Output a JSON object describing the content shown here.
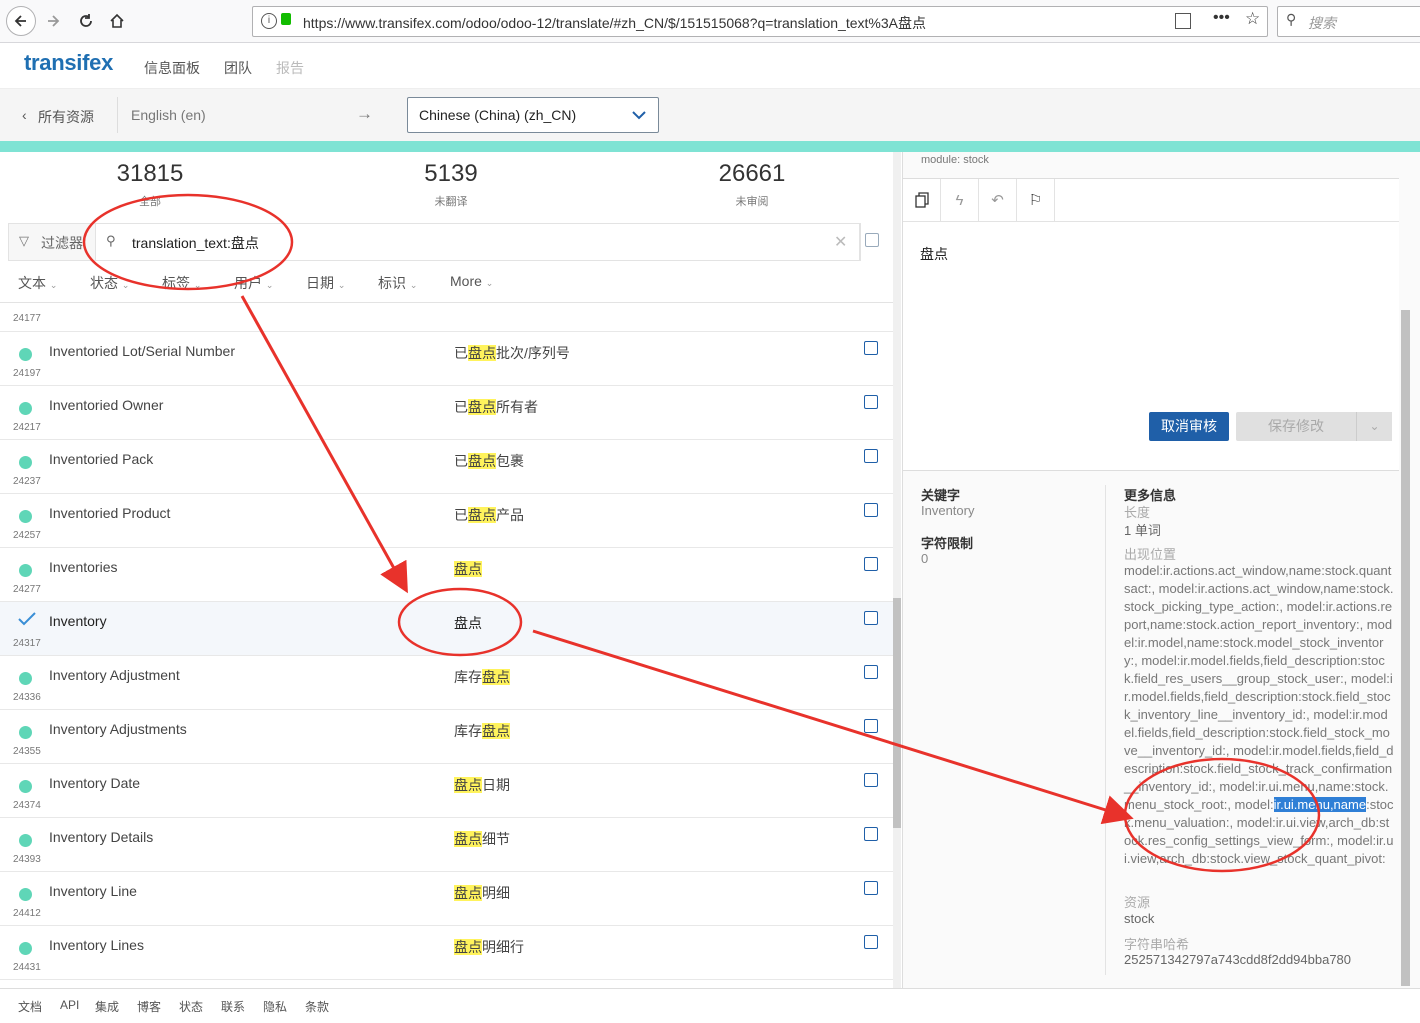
{
  "browser": {
    "url": "https://www.transifex.com/odoo/odoo-12/translate/#zh_CN/$/151515068?q=translation_text%3A盘点",
    "search_placeholder": "搜索",
    "url_icon": "info-icon",
    "menu_icon": "more-icon",
    "star_icon": "star-icon"
  },
  "app": {
    "logo": "transifex",
    "nav": [
      "信息面板",
      "团队",
      "报告"
    ]
  },
  "lang": {
    "back_label": "所有资源",
    "source": "English (en)",
    "arrow": "→",
    "target": "Chinese (China) (zh_CN)"
  },
  "stats": [
    {
      "value": "31815",
      "label": "全部"
    },
    {
      "value": "5139",
      "label": "未翻译"
    },
    {
      "value": "26661",
      "label": "未审阅"
    }
  ],
  "filter": {
    "label": "过滤器",
    "query": "translation_text:盘点"
  },
  "sort_options": [
    "文本",
    "状态",
    "标签",
    "用户",
    "日期",
    "标识",
    "More"
  ],
  "rows": [
    {
      "id": "24177",
      "source": "",
      "pre": "",
      "hl": "",
      "post": ""
    },
    {
      "id": "24197",
      "source": "Inventoried Lot/Serial Number",
      "pre": "已",
      "hl": "盘点",
      "post": "批次/序列号"
    },
    {
      "id": "24217",
      "source": "Inventoried Owner",
      "pre": "已",
      "hl": "盘点",
      "post": "所有者"
    },
    {
      "id": "24237",
      "source": "Inventoried Pack",
      "pre": "已",
      "hl": "盘点",
      "post": "包裹"
    },
    {
      "id": "24257",
      "source": "Inventoried Product",
      "pre": "已",
      "hl": "盘点",
      "post": "产品"
    },
    {
      "id": "24277",
      "source": "Inventories",
      "pre": "",
      "hl": "盘点",
      "post": ""
    },
    {
      "id": "24317",
      "source": "Inventory",
      "pre": "盘点",
      "hl": "",
      "post": ""
    },
    {
      "id": "24336",
      "source": "Inventory Adjustment",
      "pre": "库存",
      "hl": "盘点",
      "post": ""
    },
    {
      "id": "24355",
      "source": "Inventory Adjustments",
      "pre": "库存",
      "hl": "盘点",
      "post": ""
    },
    {
      "id": "24374",
      "source": "Inventory Date",
      "pre": "",
      "hl": "盘点",
      "post": "日期"
    },
    {
      "id": "24393",
      "source": "Inventory Details",
      "pre": "",
      "hl": "盘点",
      "post": "细节"
    },
    {
      "id": "24412",
      "source": "Inventory Line",
      "pre": "",
      "hl": "盘点",
      "post": "明细"
    },
    {
      "id": "24431",
      "source": "Inventory Lines",
      "pre": "",
      "hl": "盘点",
      "post": "明细行"
    }
  ],
  "editor": {
    "module": "module: stock",
    "text": "盘点",
    "cancel_review": "取消审核",
    "save": "保存修改",
    "tools": [
      "copy-icon",
      "lightning-icon",
      "undo-icon",
      "pin-icon"
    ]
  },
  "details": {
    "keyword_label": "关键字",
    "keyword": "Inventory",
    "char_limit_label": "字符限制",
    "char_limit": "0",
    "more_info_label": "更多信息",
    "length_label": "长度",
    "length": "1 单词",
    "occurrences_label": "出现位置",
    "occ_before": "model:ir.actions.act_window,name:stock.quantsact:, model:ir.actions.act_window,name:stock.stock_picking_type_action:, model:ir.actions.report,name:stock.action_report_inventory:, model:ir.model,name:stock.model_stock_inventory:, model:ir.model.fields,field_description:stock.field_res_users__group_stock_user:, model:ir.model.fields,field_description:stock.field_stock_inventory_line__inventory_id:, model:ir.model.fields,field_description:stock.field_stock_move__inventory_id:, model:ir.model.fields,field_description:stock.field_stock_track_confirmation__inventory_id:, model:ir.ui.menu,name:stock.menu_stock_root:, model:",
    "occ_selected": "ir.ui.menu,name",
    "occ_after": ":stock.menu_valuation:, model:ir.ui.view,arch_db:stock.res_config_settings_view_form:, model:ir.ui.view,arch_db:stock.view_stock_quant_pivot:",
    "resource_label": "资源",
    "resource": "stock",
    "hash_label": "字符串哈希",
    "hash": "252571342797a743cdd8f2dd94bba780"
  },
  "footer": [
    "文档",
    "API",
    "集成",
    "博客",
    "状态",
    "联系",
    "隐私",
    "条款"
  ],
  "annotation_color": "#e8322b"
}
